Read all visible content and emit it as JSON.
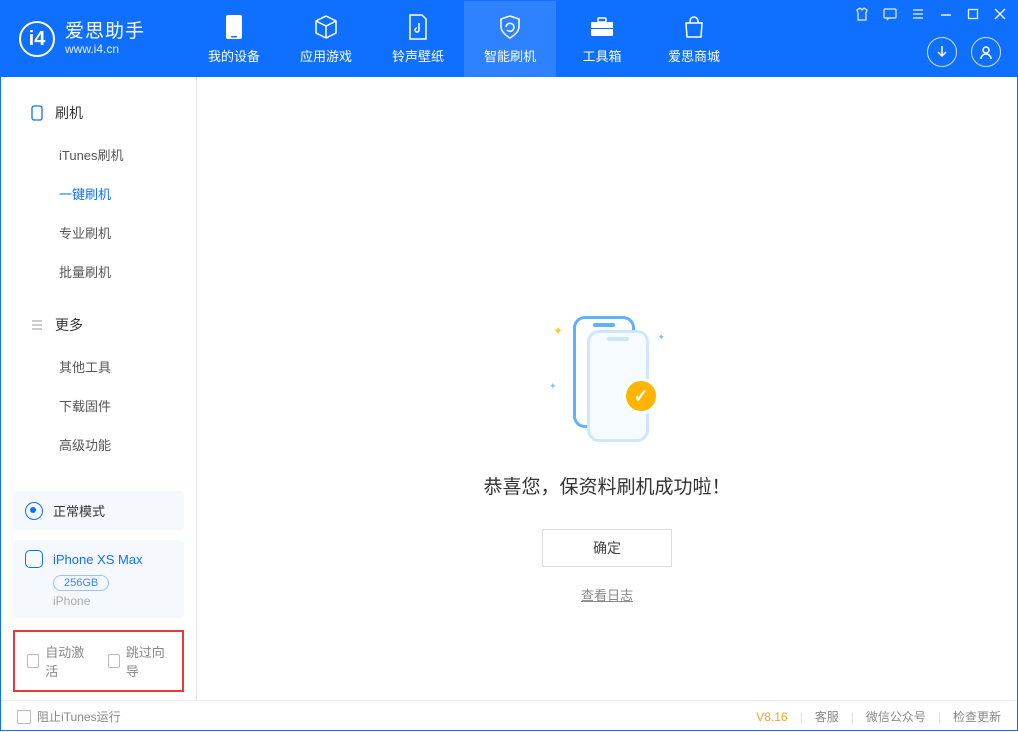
{
  "logo": {
    "cn": "爱思助手",
    "url": "www.i4.cn"
  },
  "nav": {
    "device": "我的设备",
    "apps": "应用游戏",
    "ring": "铃声壁纸",
    "flash": "智能刷机",
    "toolbox": "工具箱",
    "store": "爱思商城"
  },
  "sidebar": {
    "sectionFlash": "刷机",
    "itunes": "iTunes刷机",
    "oneclick": "一键刷机",
    "pro": "专业刷机",
    "batch": "批量刷机",
    "sectionMore": "更多",
    "other": "其他工具",
    "download": "下载固件",
    "advanced": "高级功能"
  },
  "mode": {
    "label": "正常模式"
  },
  "device": {
    "name": "iPhone XS Max",
    "storage": "256GB",
    "type": "iPhone"
  },
  "checks": {
    "autoActivate": "自动激活",
    "skipGuide": "跳过向导"
  },
  "main": {
    "title": "恭喜您，保资料刷机成功啦！",
    "ok": "确定",
    "log": "查看日志"
  },
  "footer": {
    "blockItunes": "阻止iTunes运行",
    "version": "V8.16",
    "service": "客服",
    "wechat": "微信公众号",
    "update": "检查更新"
  }
}
